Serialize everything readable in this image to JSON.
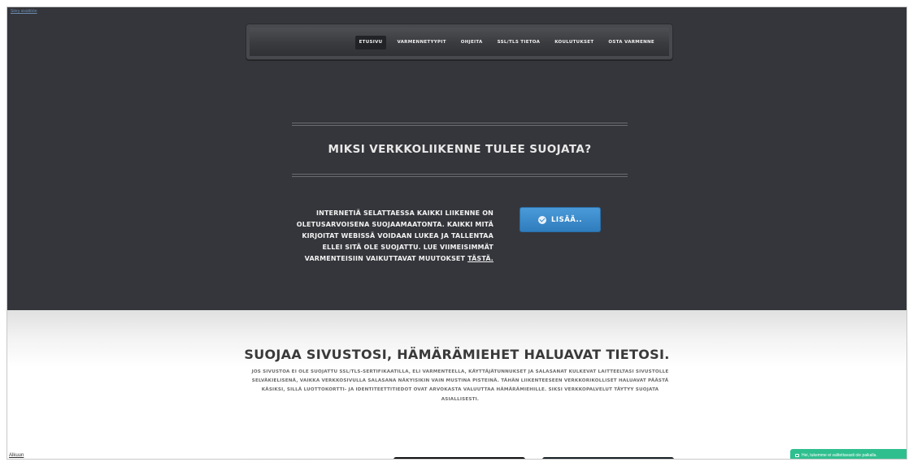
{
  "page": {
    "skip_link": "Siirry sisältöön"
  },
  "nav": {
    "items": [
      {
        "label": "ETUSIVU",
        "active": true
      },
      {
        "label": "VARMENNETYYPIT",
        "active": false
      },
      {
        "label": "OHJEITA",
        "active": false
      },
      {
        "label": "SSL/TLS TIETOA",
        "active": false
      },
      {
        "label": "KOULUTUKSET",
        "active": false
      },
      {
        "label": "OSTA VARMENNE",
        "active": false
      }
    ]
  },
  "hero": {
    "title": "MIKSI VERKKOLIIKENNE TULEE SUOJATA?",
    "text": "INTERNETIÄ SELATTAESSA KAIKKI LIIKENNE ON OLETUSARVOISENA SUOJAAMAATONTA. KAIKKI MITÄ KIRJOITAT WEBISSÄ VOIDAAN LUKEA JA TALLENTAA ELLEI SITÄ OLE SUOJATTU. LUE VIIMEISIMMÄT VARMENTEISIIN VAIKUTTAVAT MUUTOKSET",
    "link_text": "TÄSTÄ.",
    "button_label": "LISÄÄ..",
    "button_icon": "check-circle-icon",
    "accent_color": "#3a8bcb",
    "background_color": "#35363b"
  },
  "section": {
    "title": "SUOJAA SIVUSTOSI, HÄMÄRÄMIEHET HALUAVAT TIETOSI.",
    "body": "JOS SIVUSTOA EI OLE SUOJATTU SSL/TLS-SERTIFIKAATILLA, ELI VARMENTEELLA, KÄYTTÄJÄTUNNUKSET JA SALASANAT KULKEVAT LAITTEELTASI SIVUSTOLLE SELVÄKIELISENÄ, VAIKKA VERKKOSIVULLA SALASANA NÄKYISIKIN VAIN MUSTINA PISTEINÄ. TÄHÄN LIIKENTEESEEN VERKKORIKOLLISET HALUAVAT PÄÄSTÄ KÄSIKSI, SILLÄ LUOTTOKORTTI- JA IDENTITEETTITIEDOT OVAT ARVOKASTA VALUUTTAA HÄMÄRÄMIEHILLE. SIKSI VERKKOPALVELUT TÄYTYY SUOJATA ASIALLISESTI."
  },
  "footer": {
    "top_link": "Alkuun",
    "chat_label": "Hei, tukemme ei valitettavasti ole paikalla.",
    "chat_color": "#2fbf8f"
  }
}
